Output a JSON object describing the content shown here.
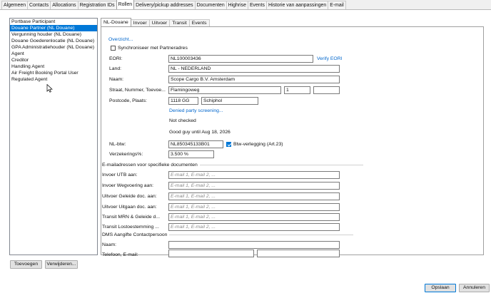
{
  "top_tabs": [
    "Algemeen",
    "Contacts",
    "Allocations",
    "Registration IDs",
    "Rollen",
    "Delivery/pickup addresses",
    "Documenten",
    "Highrise",
    "Events",
    "Historie van aanpassingen",
    "E-mail"
  ],
  "top_tab_active": "Rollen",
  "roles": [
    "Portbase Participant",
    "Douane Partner (NL Douane)",
    "Vergunning houder (NL Douane)",
    "Douane Goederenlocatie (NL Douane)",
    "GPA Administratiehouder (NL Douane)",
    "Agent",
    "Creditor",
    "Handling Agent",
    "Air Freight Booking Portal User",
    "Regulated Agent"
  ],
  "role_selected": "Douane Partner (NL Douane)",
  "buttons": {
    "add": "Toevoegen",
    "remove": "Verwijderen...",
    "save": "Opslaan",
    "cancel": "Annuleren"
  },
  "sub_tabs": [
    "NL-Douane",
    "Invoer",
    "Uitvoer",
    "Transit",
    "Events"
  ],
  "sub_tab_active": "NL-Douane",
  "form": {
    "overview_link": "Overzicht...",
    "sync_label": "Synchroniseer met Partneradres",
    "sync_checked": false,
    "eori_label": "EORI:",
    "eori_value": "NL100003436",
    "verify_link": "Verify EORI",
    "country_label": "Land:",
    "country_value": "NL - NEDERLAND",
    "name_label": "Naam:",
    "name_value": "Scope Cargo B.V. Amsterdam",
    "street_label": "Straat, Nummer, Toevoe...",
    "street_value": "Flamingoweg",
    "number_value": "1",
    "addition_value": "",
    "postcode_label": "Postcode, Plaats:",
    "postcode_value": "1118 GG",
    "city_value": "Schiphol",
    "denied_link": "Denied party screening...",
    "status_checked": "Not checked",
    "good_guy": "Good guy until Aug 18, 2026",
    "vat_label": "NL-btw:",
    "vat_value": "NL850345133B01",
    "vat_shift_label": "Btw-verlegging (Art.23)",
    "vat_shift_checked": true,
    "guarantee_label": "Verzekerings%:",
    "guarantee_value": "3.500 %"
  },
  "email_section": {
    "title": "E-mailadressen voor specifieke documenten",
    "placeholder": "E-mail 1, E-mail 2, ...",
    "rows": [
      {
        "label": "Invoer UTB aan:",
        "value": ""
      },
      {
        "label": "Invoer Wegvoering aan:",
        "value": ""
      },
      {
        "label": "Uitvoer Geleide doc. aan:",
        "value": ""
      },
      {
        "label": "Uitvoer Uitgaan doc. aan:",
        "value": ""
      },
      {
        "label": "Transit MRN & Geleide d...",
        "value": ""
      },
      {
        "label": "Transit Lostoestemming ...",
        "value": ""
      }
    ]
  },
  "contact_section": {
    "title": "DMS Aangifte Contactpersoon",
    "name_label": "Naam:",
    "name_value": "",
    "phone_label": "Telefoon, E-mail:",
    "phone_value": "",
    "email_value": ""
  },
  "icons": {
    "cursor": "mouse-pointer-icon",
    "checkmark": "checkmark-icon"
  },
  "colors": {
    "selection": "#0078d7",
    "link": "#0066cc"
  }
}
